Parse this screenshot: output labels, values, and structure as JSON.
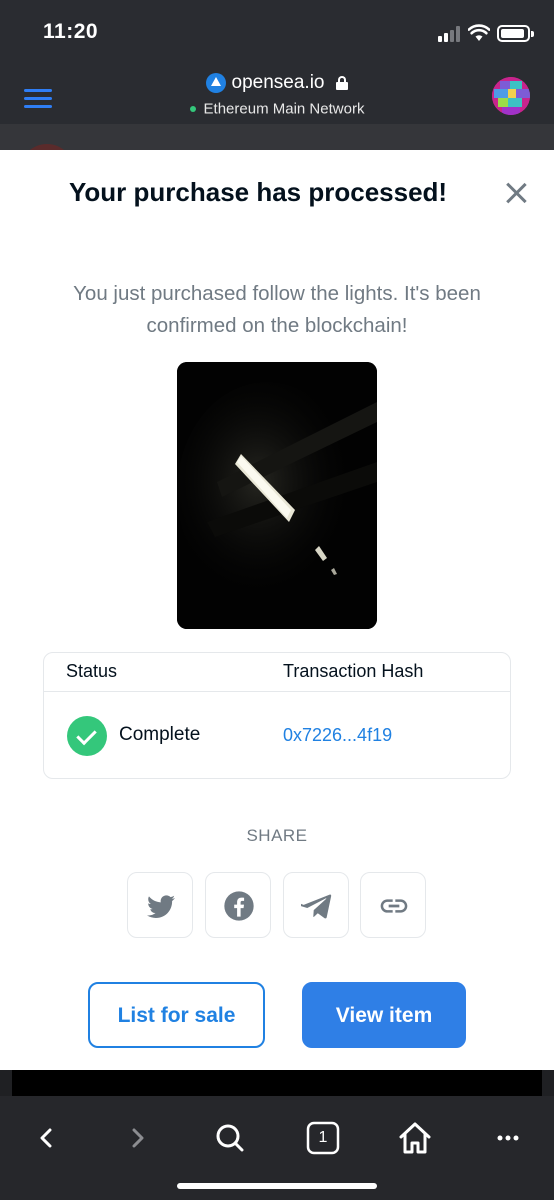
{
  "status_bar": {
    "time": "11:20"
  },
  "browser": {
    "site": "opensea.io",
    "network": "Ethereum Main Network"
  },
  "modal": {
    "title": "Your purchase has processed!",
    "message": "You just purchased follow the lights. It's been confirmed on the blockchain!",
    "table": {
      "headers": [
        "Status",
        "Transaction Hash"
      ],
      "status": "Complete",
      "hash": "0x7226...4f19"
    },
    "share_label": "SHARE",
    "share_icons": [
      "twitter-icon",
      "facebook-icon",
      "telegram-icon",
      "link-icon"
    ],
    "buttons": {
      "list_for_sale": "List for sale",
      "view_item": "View item"
    }
  },
  "toolbar": {
    "tab_count": "1",
    "icons": [
      "back-icon",
      "forward-icon",
      "search-icon",
      "tabs-icon",
      "home-icon",
      "more-icon"
    ]
  },
  "colors": {
    "accent": "#2081e2",
    "success": "#34c77b",
    "title": "#04111d",
    "muted": "#707a83"
  }
}
